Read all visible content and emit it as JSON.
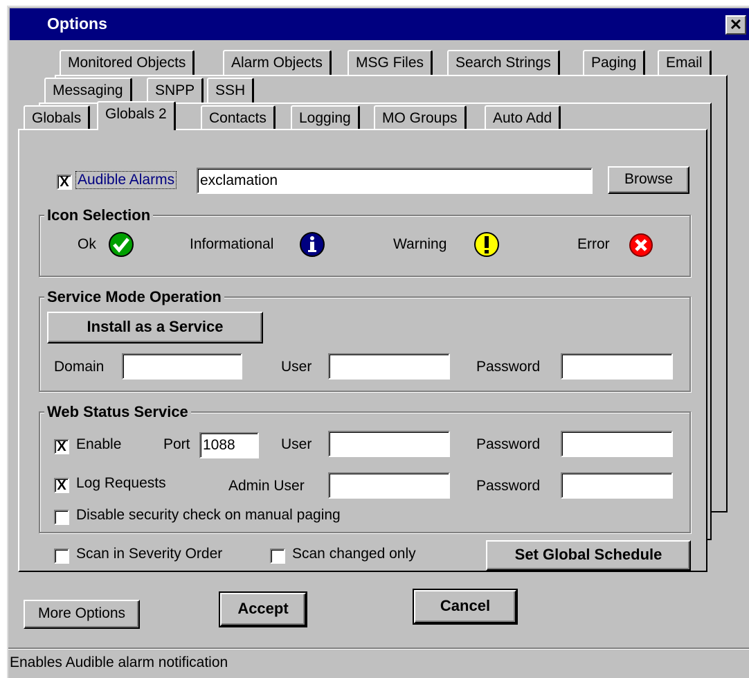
{
  "window": {
    "title": "Options",
    "close": "✕"
  },
  "tabs": {
    "row1": [
      "Monitored Objects",
      "Alarm Objects",
      "MSG Files",
      "Search Strings",
      "Paging",
      "Email"
    ],
    "row2": [
      "Messaging",
      "SNPP",
      "SSH"
    ],
    "row3": [
      "Globals",
      "Globals 2",
      "Contacts",
      "Logging",
      "MO Groups",
      "Auto Add"
    ],
    "active": "Globals 2"
  },
  "audible": {
    "checked": "X",
    "label": "Audible Alarms",
    "file_value": "exclamation",
    "browse_label": "Browse"
  },
  "icon_selection": {
    "title": "Icon Selection",
    "ok_label": "Ok",
    "info_label": "Informational",
    "warning_label": "Warning",
    "error_label": "Error",
    "icons": [
      "check-icon",
      "info-icon",
      "warning-icon",
      "error-icon"
    ],
    "colors": {
      "ok": "#00a000",
      "info": "#000080",
      "warning": "#ffff00",
      "error": "#ff0000"
    }
  },
  "service_mode": {
    "title": "Service Mode Operation",
    "install_label": "Install as a Service",
    "domain_label": "Domain",
    "domain_value": "",
    "user_label": "User",
    "user_value": "",
    "password_label": "Password",
    "password_value": ""
  },
  "web_status": {
    "title": "Web Status Service",
    "enable_checked": "X",
    "enable_label": "Enable",
    "port_label": "Port",
    "port_value": "1088",
    "user_label": "User",
    "user_value": "",
    "password_label": "Password",
    "password_value": "",
    "log_checked": "X",
    "log_label": "Log Requests",
    "admin_user_label": "Admin User",
    "admin_user_value": "",
    "admin_password_label": "Password",
    "admin_password_value": "",
    "disable_checked": "",
    "disable_label": "Disable security check on manual paging"
  },
  "scan": {
    "severity_checked": "",
    "severity_label": "Scan in Severity Order",
    "changed_checked": "",
    "changed_label": "Scan changed only",
    "schedule_label": "Set Global Schedule"
  },
  "footer": {
    "more_label": "More Options",
    "accept_label": "Accept",
    "cancel_label": "Cancel"
  },
  "status": "Enables Audible alarm notification"
}
